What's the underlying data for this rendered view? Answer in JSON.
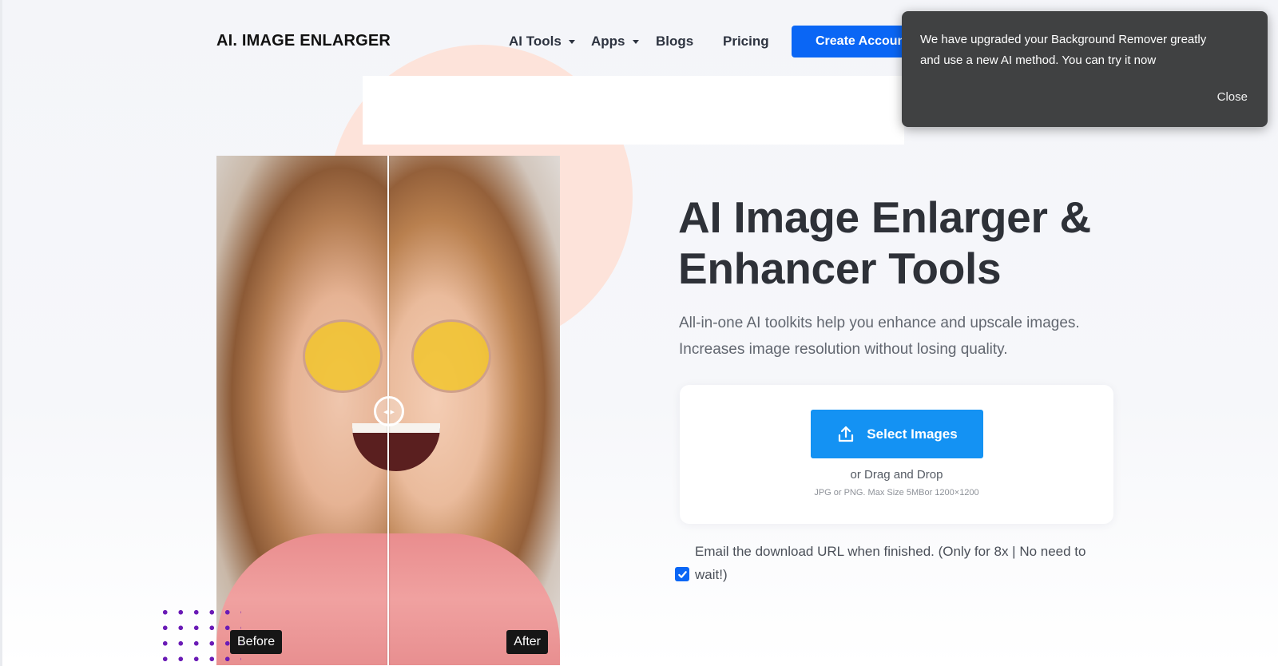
{
  "header": {
    "logo": "AI. IMAGE ENLARGER",
    "nav": [
      {
        "label": "AI Tools",
        "has_dropdown": true
      },
      {
        "label": "Apps",
        "has_dropdown": true
      },
      {
        "label": "Blogs",
        "has_dropdown": false
      },
      {
        "label": "Pricing",
        "has_dropdown": false
      }
    ],
    "create_account_label": "Create Account"
  },
  "comparison": {
    "before_label": "Before",
    "after_label": "After",
    "handle_icon": "left-right-arrows-icon"
  },
  "hero": {
    "title_line1": "AI Image Enlarger &",
    "title_line2": "Enhancer Tools",
    "subtitle_line1": "All-in-one AI toolkits help you enhance and upscale images.",
    "subtitle_line2": "Increases image resolution without losing quality."
  },
  "upload": {
    "button_label": "Select Images",
    "button_icon": "upload-icon",
    "drag_text": "or Drag and Drop",
    "hint": "JPG or PNG. Max Size 5MBor 1200×1200"
  },
  "email_option": {
    "checked": true,
    "line1": "Email the download URL when finished. (Only for 8x | No need to",
    "line2": "wait!)"
  },
  "toast": {
    "message_line1": "We have upgraded your Background Remover greatly",
    "message_line2": "and use a new AI method. You can try it now",
    "close_label": "Close"
  },
  "colors": {
    "primary_blue": "#0a66f5",
    "select_button_blue": "#1492f3",
    "toast_bg": "#404142",
    "peach_accent": "#fde3da",
    "dots_purple": "#6a1bb6"
  }
}
